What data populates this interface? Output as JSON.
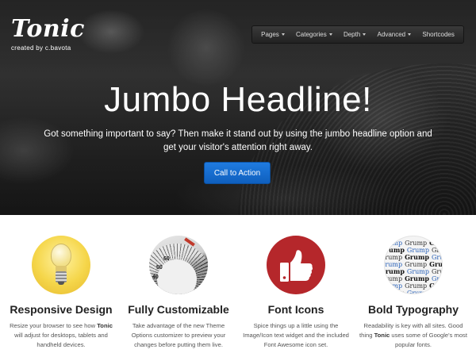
{
  "site": {
    "logo": "Tonic",
    "tagline": "created by c.bavota"
  },
  "nav": {
    "items": [
      {
        "label": "Pages",
        "dropdown": true
      },
      {
        "label": "Categories",
        "dropdown": true
      },
      {
        "label": "Depth",
        "dropdown": true
      },
      {
        "label": "Advanced",
        "dropdown": true
      },
      {
        "label": "Shortcodes",
        "dropdown": false
      }
    ]
  },
  "hero": {
    "headline": "Jumbo Headline!",
    "subtext": "Got something important to say? Then make it stand out by using the jumbo headline option and get your visitor's attention right away.",
    "cta_label": "Call to Action"
  },
  "features": [
    {
      "title": "Responsive Design",
      "text_before": "Resize your browser to see how ",
      "text_bold": "Tonic",
      "text_after": " will adjust for desktops, tablets and handheld devices.",
      "icon": "lightbulb-icon"
    },
    {
      "title": "Fully Customizable",
      "text_before": "Take advantage of the new Theme Options customizer to preview your changes before putting them live.",
      "text_bold": "",
      "text_after": "",
      "icon": "dial-icon",
      "dial_numbers": [
        "60",
        "50",
        "40"
      ]
    },
    {
      "title": "Font Icons",
      "text_before": "Spice things up a little using the Image/Icon text widget and the included Font Awesome icon set.",
      "text_bold": "",
      "text_after": "",
      "icon": "thumbs-up-icon"
    },
    {
      "title": "Bold Typography",
      "text_before": "Readability is key with all sites. Good thing ",
      "text_bold": "Tonic",
      "text_after": " uses some of Google's most popular fonts.",
      "icon": "typography-icon",
      "type_sample": "Grump"
    }
  ],
  "colors": {
    "cta": "#1f7be0",
    "thumb_circle": "#b5272b",
    "bulb_circle": "#f5d64a"
  }
}
